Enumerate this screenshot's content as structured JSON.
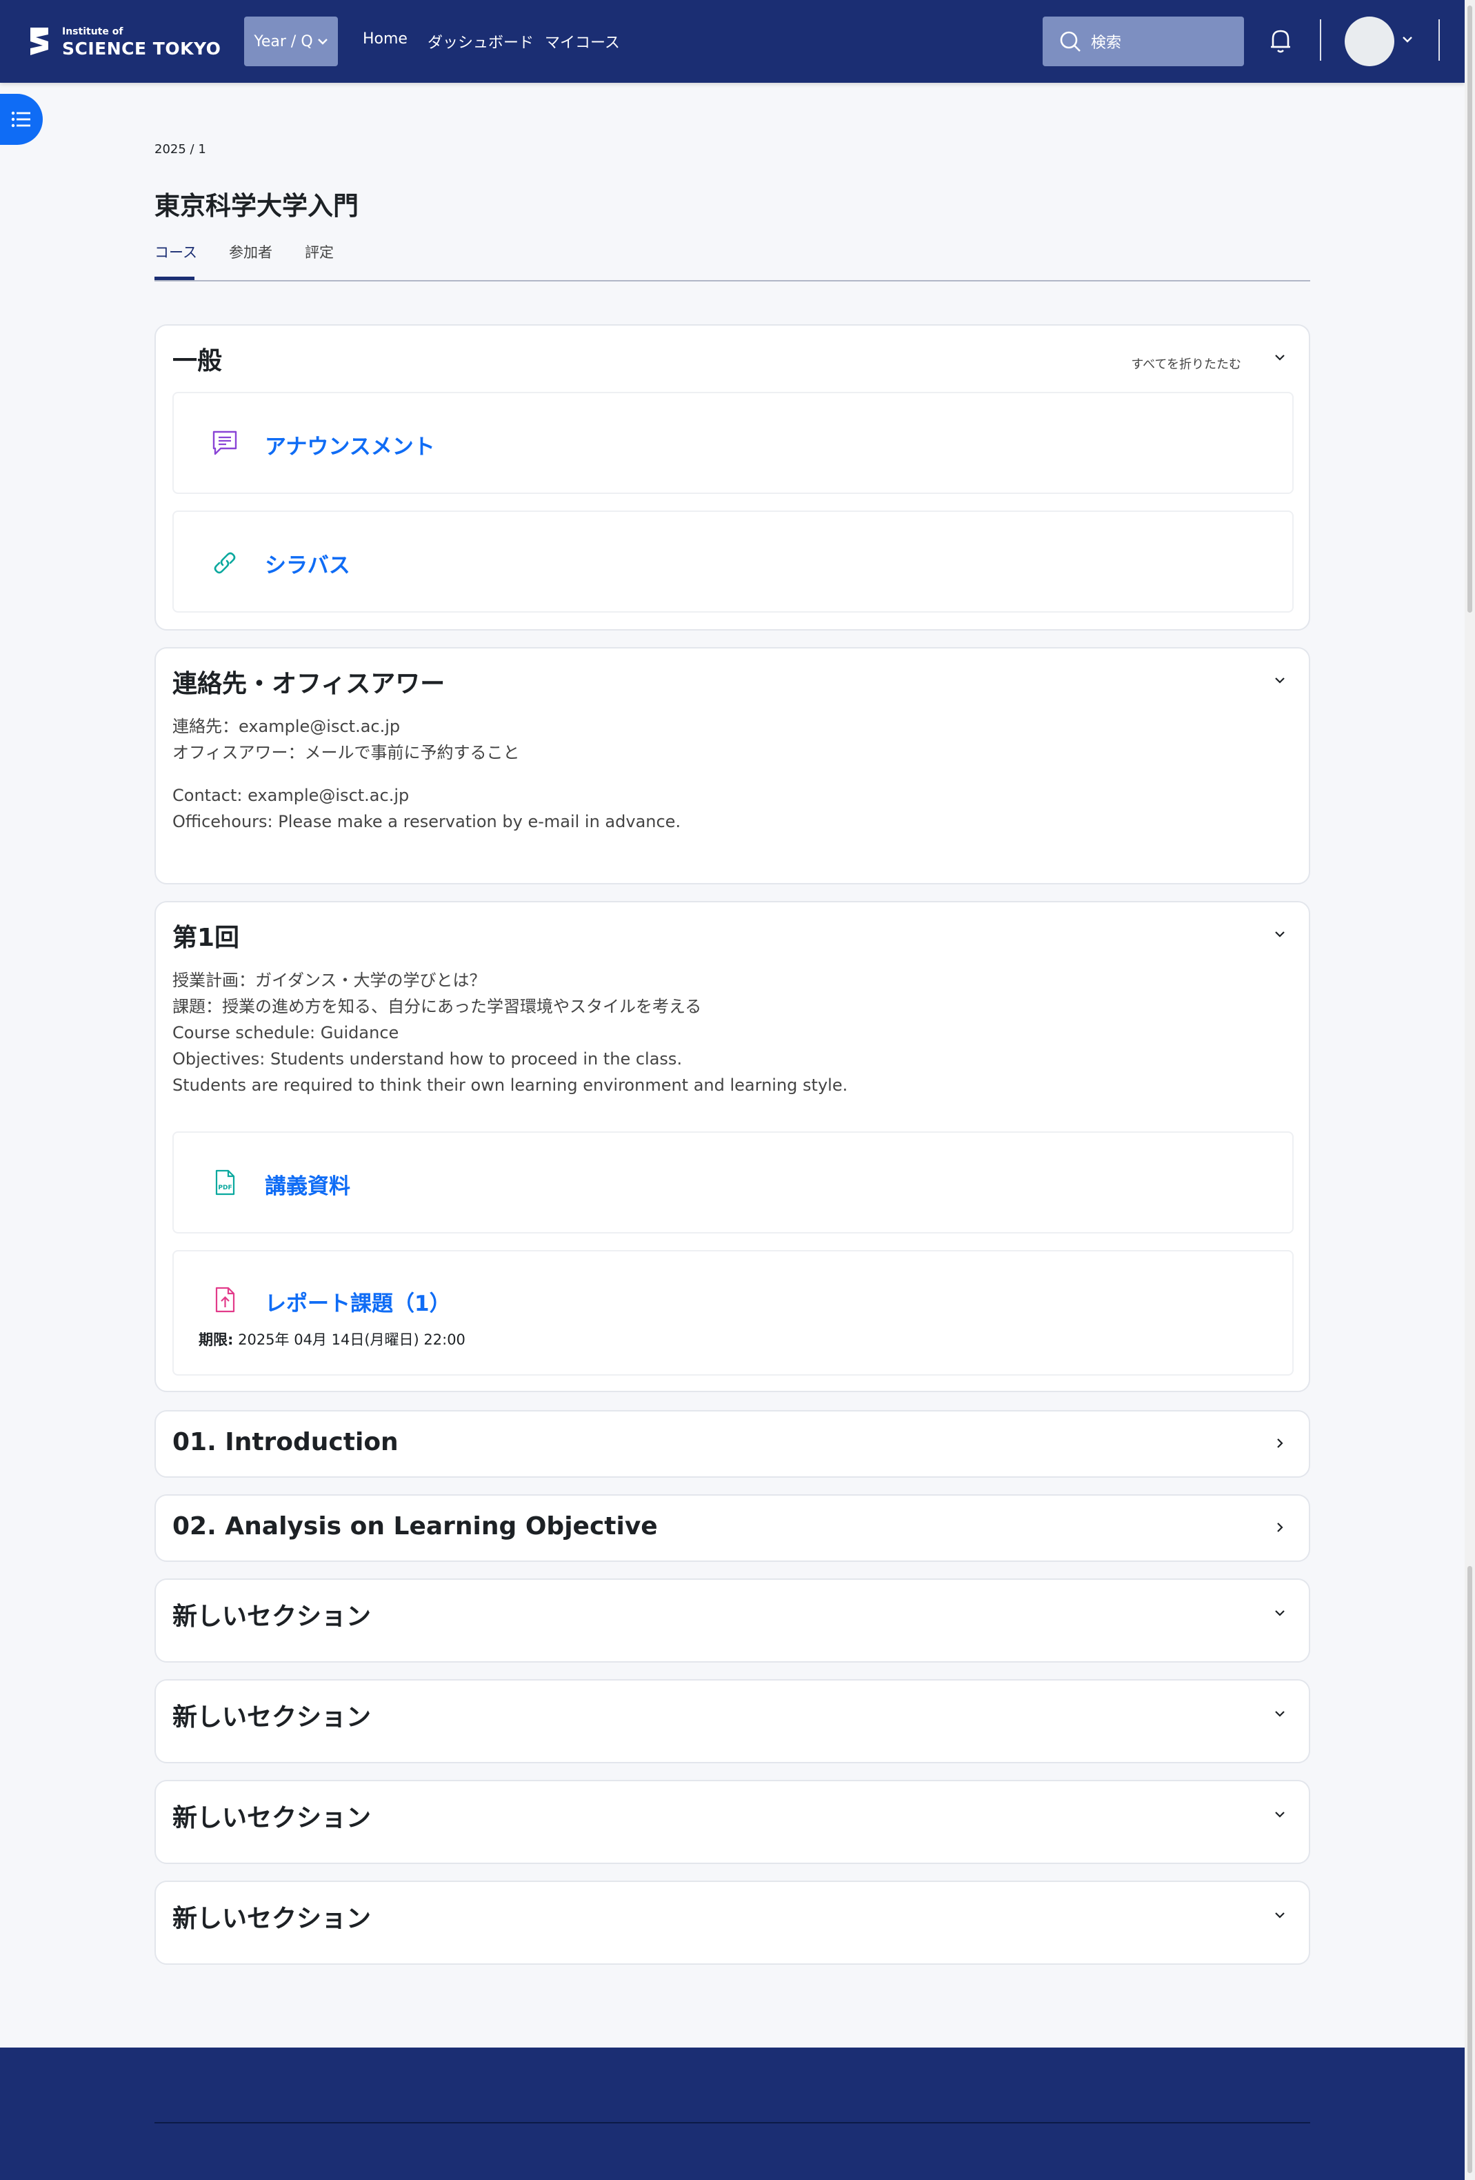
{
  "header": {
    "logo_small": "Institute of",
    "logo_big": "SCIENCE TOKYO",
    "year_button": "Year / Q",
    "nav": [
      "Home",
      "ダッシュボード",
      "マイコース"
    ],
    "search_placeholder": "検索"
  },
  "page": {
    "breadcrumb": "2025 / 1",
    "title": "東京科学大学入門",
    "tabs": [
      "コース",
      "参加者",
      "評定"
    ]
  },
  "sections": {
    "general": {
      "title": "一般",
      "collapse_all": "すべてを折りたたむ",
      "activities": [
        "アナウンスメント",
        "シラバス"
      ]
    },
    "contact": {
      "title": "連絡先・オフィスアワー",
      "lines_ja": [
        "連絡先：example@isct.ac.jp",
        "オフィスアワー：メールで事前に予約すること"
      ],
      "lines_en": [
        "Contact: example@isct.ac.jp",
        "Officehours: Please make a reservation by e-mail in advance."
      ]
    },
    "week1": {
      "title": "第1回",
      "lines": [
        "授業計画：ガイダンス・大学の学びとは？",
        "課題：授業の進め方を知る、自分にあった学習環境やスタイルを考える",
        "Course schedule: Guidance",
        "Objectives: Students understand how to proceed in the class.",
        "Students are required to think their own learning environment and learning style."
      ],
      "activities": [
        "講義資料",
        "レポート課題（1）"
      ],
      "deadline_label": "期限:",
      "deadline_value": "2025年 04月 14日(月曜日) 22:00"
    },
    "collapsed": [
      "01. Introduction",
      "02. Analysis on Learning Objective"
    ],
    "new_sections": [
      "新しいセクション",
      "新しいセクション",
      "新しいセクション",
      "新しいセクション"
    ]
  },
  "colors": {
    "navbar": "#1b2e73",
    "link": "#0f6cf5",
    "forum_icon": "#8a44d6",
    "url_icon": "#0aa89e",
    "assign_icon": "#e23b8a"
  }
}
